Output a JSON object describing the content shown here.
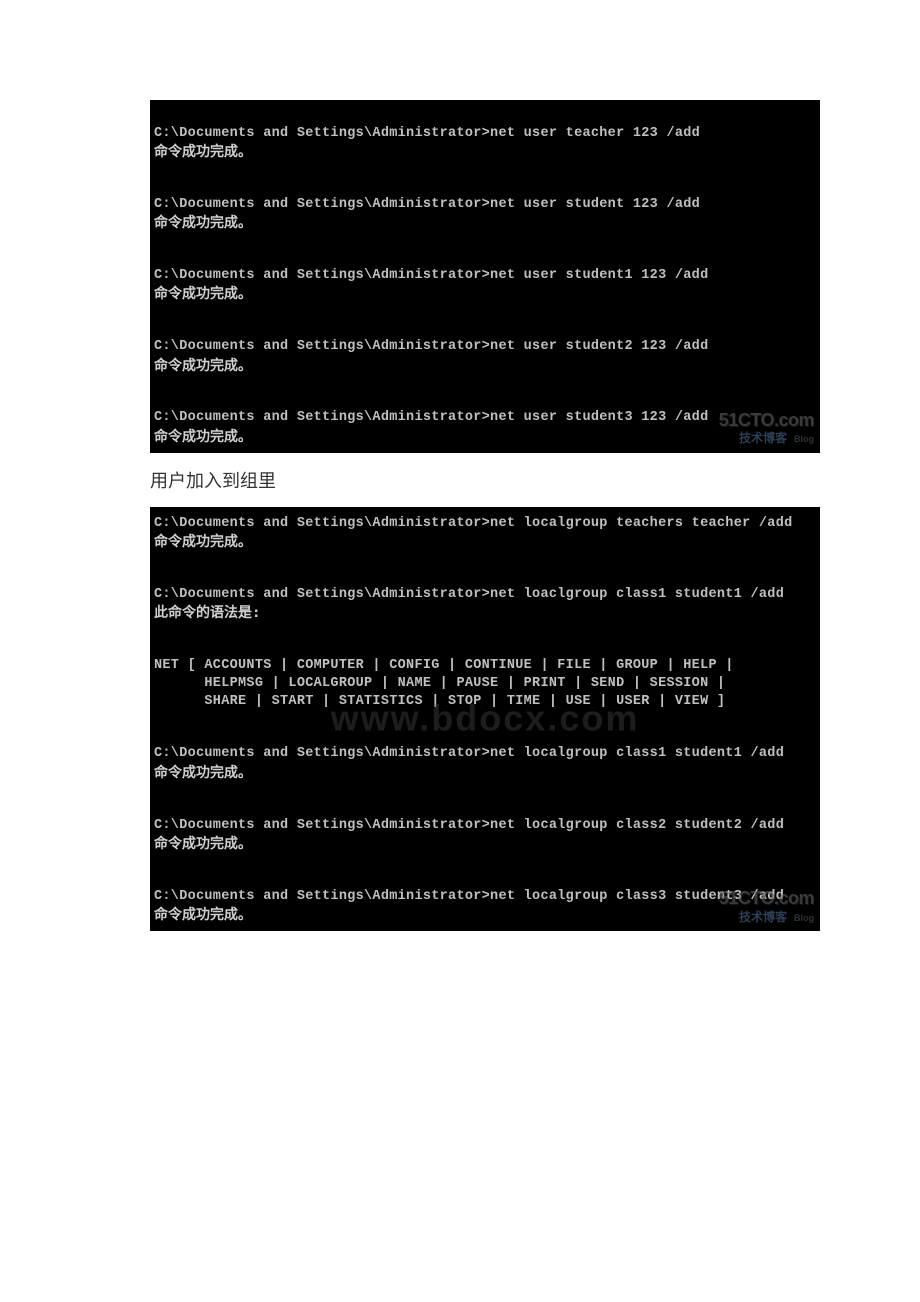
{
  "terminal1": {
    "lines": [
      {
        "type": "blank"
      },
      {
        "type": "cmd",
        "text": "C:\\Documents and Settings\\Administrator>net user teacher 123 /add"
      },
      {
        "type": "cn",
        "text": "命令成功完成。"
      },
      {
        "type": "blank"
      },
      {
        "type": "blank"
      },
      {
        "type": "cmd",
        "text": "C:\\Documents and Settings\\Administrator>net user student 123 /add"
      },
      {
        "type": "cn",
        "text": "命令成功完成。"
      },
      {
        "type": "blank"
      },
      {
        "type": "blank"
      },
      {
        "type": "cmd",
        "text": "C:\\Documents and Settings\\Administrator>net user student1 123 /add"
      },
      {
        "type": "cn",
        "text": "命令成功完成。"
      },
      {
        "type": "blank"
      },
      {
        "type": "blank"
      },
      {
        "type": "cmd",
        "text": "C:\\Documents and Settings\\Administrator>net user student2 123 /add"
      },
      {
        "type": "cn",
        "text": "命令成功完成。"
      },
      {
        "type": "blank"
      },
      {
        "type": "blank"
      },
      {
        "type": "cmd",
        "text": "C:\\Documents and Settings\\Administrator>net user student3 123 /add"
      },
      {
        "type": "cn",
        "text": "命令成功完成。"
      }
    ]
  },
  "caption": "用户加入到组里",
  "terminal2": {
    "lines": [
      {
        "type": "cmd",
        "text": "C:\\Documents and Settings\\Administrator>net localgroup teachers teacher /add"
      },
      {
        "type": "cn",
        "text": "命令成功完成。"
      },
      {
        "type": "blank"
      },
      {
        "type": "blank"
      },
      {
        "type": "cmd",
        "text": "C:\\Documents and Settings\\Administrator>net loaclgroup class1 student1 /add"
      },
      {
        "type": "cn",
        "text": "此命令的语法是:"
      },
      {
        "type": "blank"
      },
      {
        "type": "blank"
      },
      {
        "type": "cmd",
        "text": "NET [ ACCOUNTS | COMPUTER | CONFIG | CONTINUE | FILE | GROUP | HELP |"
      },
      {
        "type": "cmd",
        "text": "      HELPMSG | LOCALGROUP | NAME | PAUSE | PRINT | SEND | SESSION |"
      },
      {
        "type": "cmd",
        "text": "      SHARE | START | STATISTICS | STOP | TIME | USE | USER | VIEW ]"
      },
      {
        "type": "blank"
      },
      {
        "type": "blank"
      },
      {
        "type": "cmd",
        "text": "C:\\Documents and Settings\\Administrator>net localgroup class1 student1 /add"
      },
      {
        "type": "cn",
        "text": "命令成功完成。"
      },
      {
        "type": "blank"
      },
      {
        "type": "blank"
      },
      {
        "type": "cmd",
        "text": "C:\\Documents and Settings\\Administrator>net localgroup class2 student2 /add"
      },
      {
        "type": "cn",
        "text": "命令成功完成。"
      },
      {
        "type": "blank"
      },
      {
        "type": "blank"
      },
      {
        "type": "cmd",
        "text": "C:\\Documents and Settings\\Administrator>net localgroup class3 student3 /add"
      },
      {
        "type": "cn",
        "text": "命令成功完成。"
      }
    ]
  },
  "watermarks": {
    "center": "www.bdocx.com",
    "logo_main": "51CTO.com",
    "logo_sub": "技术博客",
    "blog_tag": "Blog"
  }
}
